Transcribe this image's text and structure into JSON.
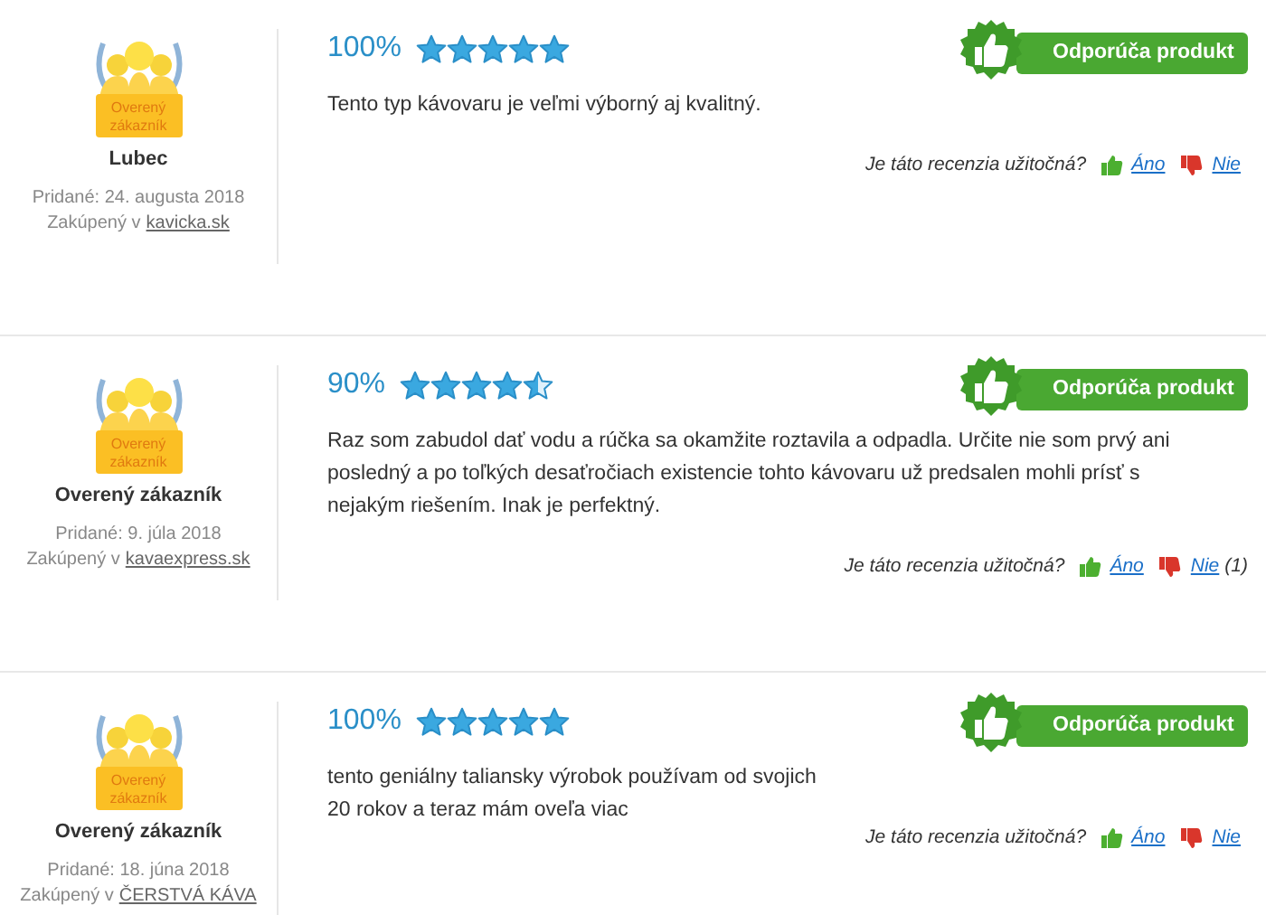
{
  "reviews": [
    {
      "badge_label": "Overený zákazník",
      "author": "Lubec",
      "added": "Pridané: 24. augusta 2018",
      "purchased_prefix": "Zakúpený v",
      "shop": "kavicka.sk",
      "percent": "100%",
      "stars": 5,
      "text": "Tento typ kávovaru je veľmi výborný aj kvalitný.",
      "recommend": "Odporúča produkt",
      "helpful_question": "Je táto recenzia užitočná?",
      "yes_label": "Áno",
      "no_label": "Nie"
    },
    {
      "badge_label": "Overený zákazník",
      "author": "Overený zákazník",
      "added": "Pridané: 9. júla 2018",
      "purchased_prefix": "Zakúpený v",
      "shop": "kavaexpress.sk",
      "percent": "90%",
      "stars": 4.5,
      "text": "Raz som zabudol dať vodu a rúčka sa okamžite roztavila a odpadla. Určite nie som prvý ani posledný a po toľkých desaťročiach existencie tohto kávovaru už predsalen mohli prísť s nejakým riešením. Inak je perfektný.",
      "recommend": "Odporúča produkt",
      "helpful_question": "Je táto recenzia užitočná?",
      "yes_label": "Áno",
      "no_label": "Nie",
      "no_count": "(1)"
    },
    {
      "badge_label": "Overený zákazník",
      "author": "Overený zákazník",
      "added": "Pridané: 18. júna 2018",
      "purchased_prefix": "Zakúpený v",
      "shop": "ČERSTVÁ KÁVA",
      "percent": "100%",
      "stars": 5,
      "text": "tento geniálny taliansky výrobok používam od svojich\n20 rokov a teraz mám oveľa viac",
      "recommend": "Odporúča produkt",
      "helpful_question": "Je táto recenzia užitočná?",
      "yes_label": "Áno",
      "no_label": "Nie"
    }
  ]
}
